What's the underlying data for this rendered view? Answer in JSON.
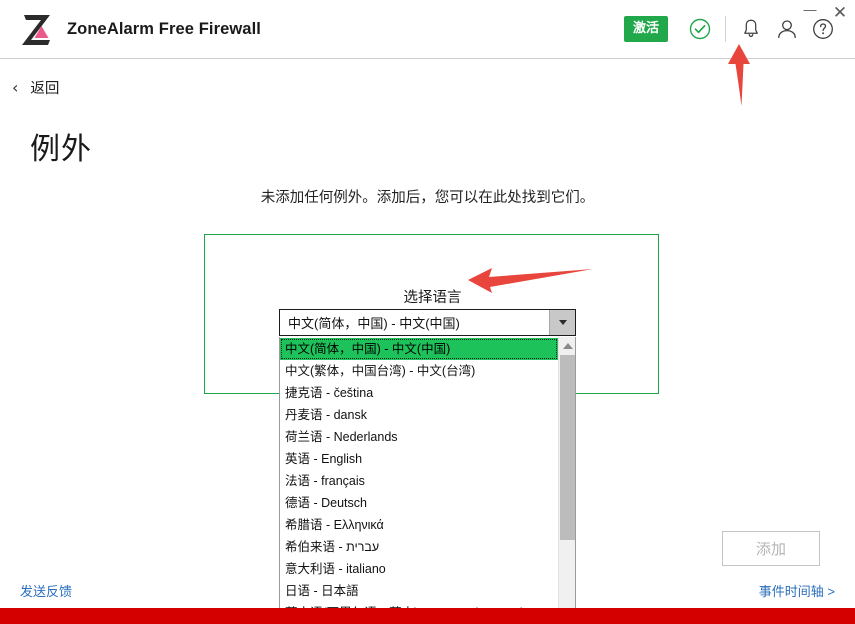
{
  "window": {
    "minimize_label": "—",
    "close_label": "✕"
  },
  "header": {
    "brand_title": "ZoneAlarm Free Firewall",
    "logo_icon": "zonealarm-logo-icon",
    "activate_label": "激活",
    "status_icon": "check-circle-icon",
    "notification_icon": "bell-icon",
    "account_icon": "person-icon",
    "help_icon": "help-circle-icon"
  },
  "nav": {
    "back_label": "返回",
    "back_icon": "chevron-left-icon"
  },
  "main": {
    "page_title": "例外",
    "empty_message": "未添加任何例外。添加后，您可以在此处找到它们。"
  },
  "language_panel": {
    "caption": "选择语言",
    "selected_value": "中文(简体，中国) - 中文(中国)",
    "caret_icon": "chevron-down-icon",
    "options": [
      "中文(简体，中国) - 中文(中国)",
      "中文(繁体，中国台湾) - 中文(台湾)",
      "捷克语 - čeština",
      "丹麦语 - dansk",
      "荷兰语 - Nederlands",
      "英语 - English",
      "法语 - français",
      "德语 - Deutsch",
      "希腊语 - Ελληνικά",
      "希伯来语 - עברית",
      "意大利语 - italiano",
      "日语 - 日本語",
      "蒙古语(西里尔语、蒙古) - монгол (Монгол)"
    ],
    "selected_index": 0,
    "scroll_up_icon": "scroll-up-arrow-icon"
  },
  "footer": {
    "feedback_label": "发送反馈",
    "add_button_label": "添加",
    "timeline_label": "事件时间轴 >"
  },
  "annotations": {
    "arrow_up_icon": "red-arrow-up-annotation",
    "arrow_left_icon": "red-arrow-left-annotation"
  },
  "colors": {
    "brand_green": "#21a84b",
    "accent_red": "#e8453c",
    "highlight_green": "#1ec25a",
    "link_blue": "#2a6ebb",
    "bottom_bar_red": "#d40000"
  }
}
